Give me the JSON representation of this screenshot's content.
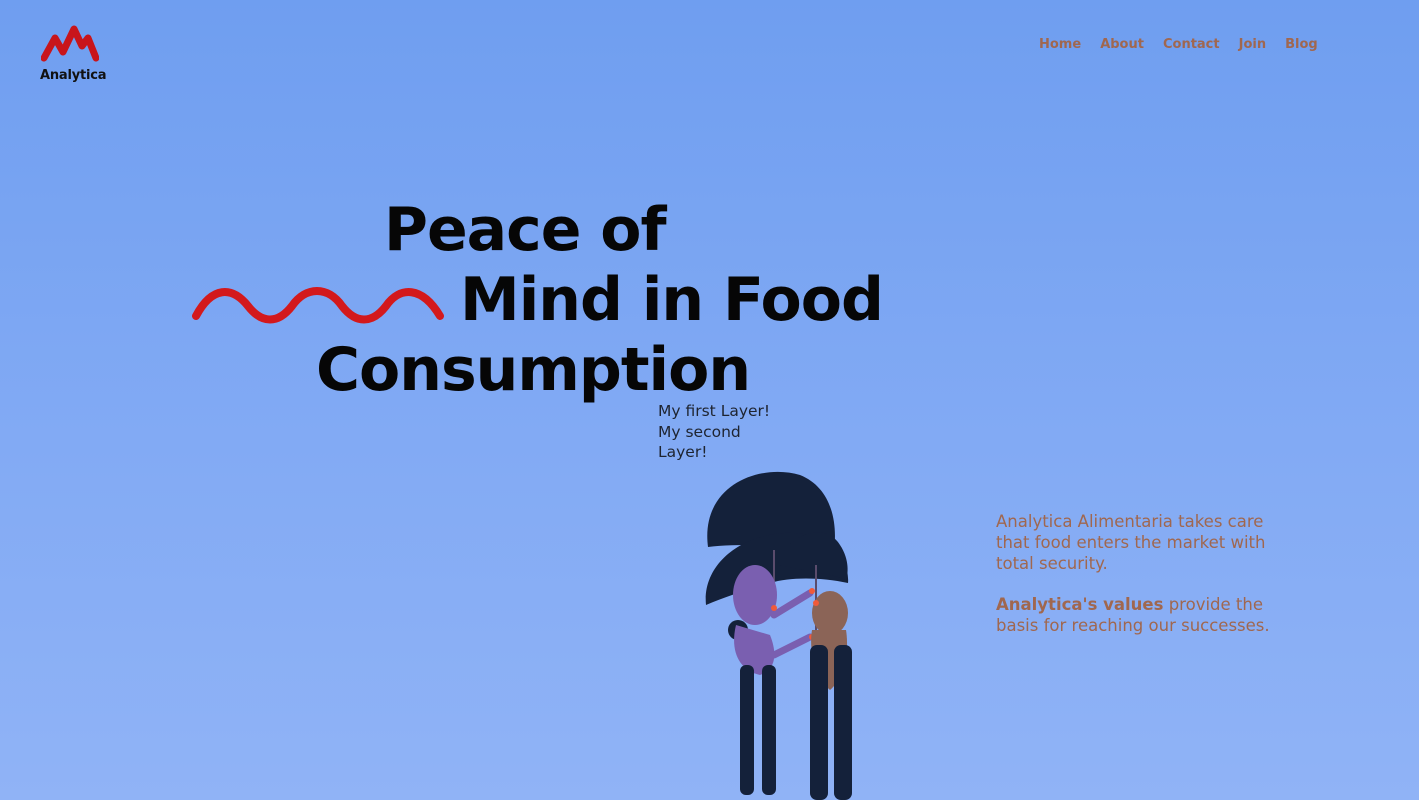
{
  "brand": {
    "name": "Analytica",
    "logo_color": "#c8151b"
  },
  "nav": {
    "items": [
      "Home",
      "About",
      "Contact",
      "Join",
      "Blog"
    ]
  },
  "hero": {
    "line1": "Peace of",
    "line2": "Mind in Food",
    "line3": "Consumption",
    "accent_color": "#d3191c"
  },
  "layers": {
    "first": "My first Layer!",
    "second": "My second Layer!"
  },
  "info": {
    "paragraph1": "Analytica Alimentaria takes care that food enters the market with total security.",
    "values_bold": "Analytica's values",
    "values_rest": " provide the basis for reaching our successes."
  },
  "colors": {
    "nav_text": "#a0674f",
    "background": "#7aa6f2",
    "headline": "#060606"
  },
  "icons": {
    "logo": "analytica-logo-icon",
    "wave": "red-wave-icon",
    "illustration": "umbrella-couple-illustration"
  }
}
